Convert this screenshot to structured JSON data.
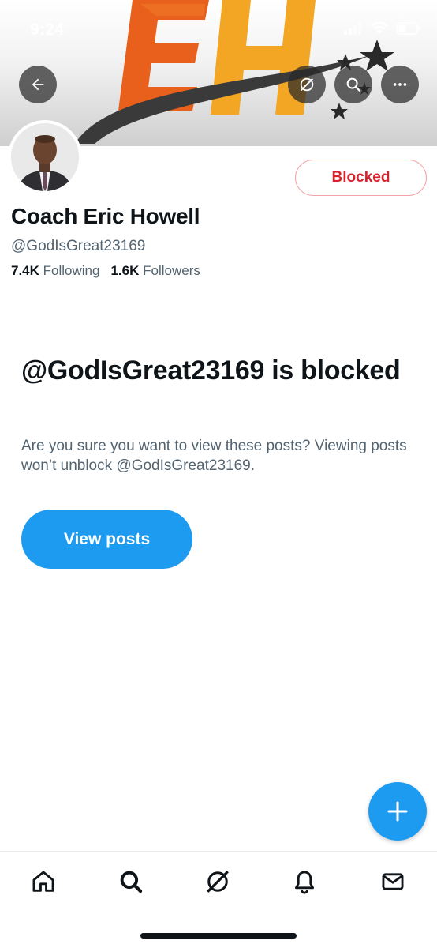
{
  "status_bar": {
    "time": "9:24"
  },
  "profile": {
    "display_name": "Coach Eric Howell",
    "handle": "@GodIsGreat23169",
    "following_count": "7.4K",
    "following_label": "Following",
    "followers_count": "1.6K",
    "followers_label": "Followers",
    "blocked_button_label": "Blocked"
  },
  "blocked_notice": {
    "title": "@GodIsGreat23169 is blocked",
    "description": "Are you sure you want to view these posts? Viewing posts won’t unblock @GodIsGreat23169.",
    "view_posts_label": "View posts"
  },
  "banner": {
    "logo_text": "EH"
  },
  "colors": {
    "accent": "#1d9bf0",
    "blocked_red": "#d8202a",
    "text_primary": "#0f1419",
    "text_secondary": "#536471",
    "banner_orange": "#e8601c",
    "banner_yellow": "#f2a623"
  },
  "icons": {
    "back": "arrow-left-icon",
    "grok": "grok-icon",
    "search": "search-icon",
    "more": "more-icon",
    "compose": "plus-icon",
    "tabs": [
      "home-icon",
      "search-icon",
      "grok-icon",
      "bell-icon",
      "mail-icon"
    ]
  }
}
